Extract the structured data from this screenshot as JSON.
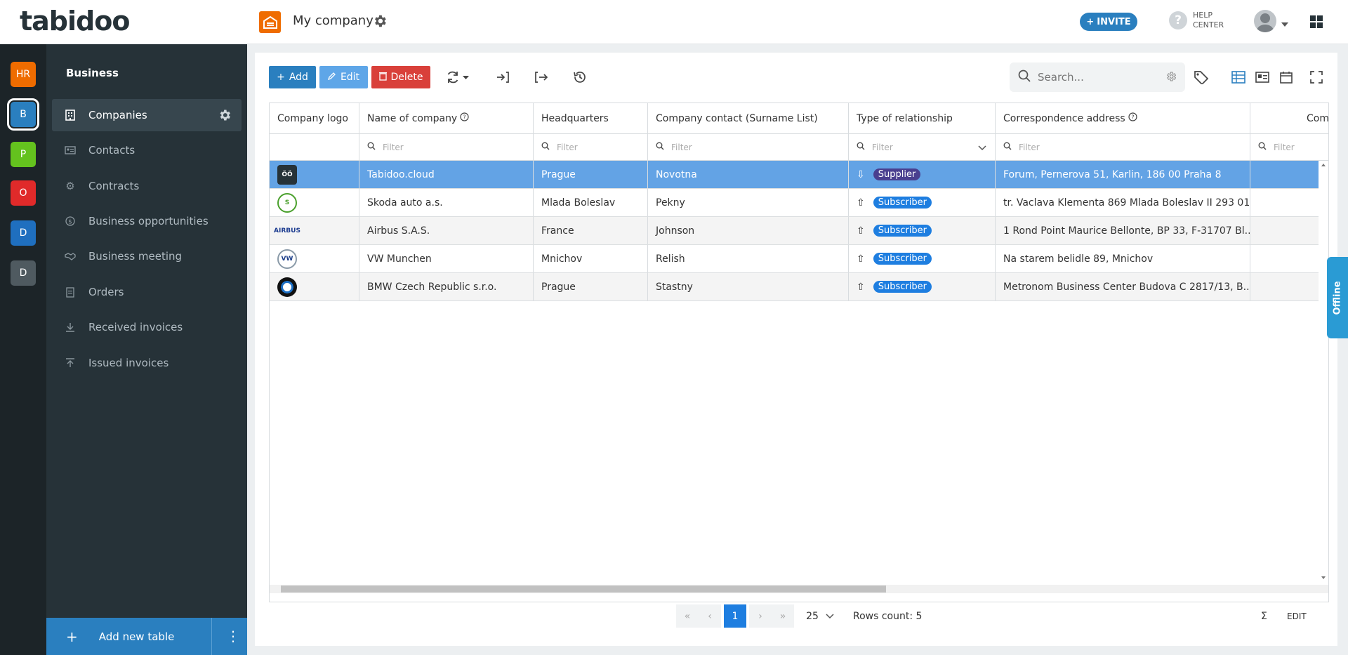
{
  "app": {
    "logo_text": "tabidoo",
    "workspace_title": "My company",
    "invite_label": "INVITE",
    "help_line1": "HELP",
    "help_line2": "CENTER"
  },
  "rail": [
    {
      "label": "HR",
      "color": "#ef6c00"
    },
    {
      "label": "B",
      "color": "#2a7fbf",
      "active": true
    },
    {
      "label": "P",
      "color": "#64c21e"
    },
    {
      "label": "O",
      "color": "#e02a2a"
    },
    {
      "label": "D",
      "color": "#1f6fbf"
    },
    {
      "label": "D",
      "color": "#4f5a60"
    }
  ],
  "sidebar": {
    "title": "Business",
    "items": [
      {
        "label": "Companies",
        "icon": "building-icon"
      },
      {
        "label": "Contacts",
        "icon": "contact-card-icon"
      },
      {
        "label": "Contracts",
        "icon": "gear-icon"
      },
      {
        "label": "Business opportunities",
        "icon": "dollar-icon"
      },
      {
        "label": "Business meeting",
        "icon": "handshake-icon"
      },
      {
        "label": "Orders",
        "icon": "document-icon"
      },
      {
        "label": "Received invoices",
        "icon": "download-icon"
      },
      {
        "label": "Issued invoices",
        "icon": "upload-icon"
      }
    ],
    "add_table_label": "Add new table"
  },
  "toolbar": {
    "add_label": "Add",
    "edit_label": "Edit",
    "delete_label": "Delete",
    "search_placeholder": "Search..."
  },
  "table": {
    "columns": [
      "Company logo",
      "Name of company",
      "Headquarters",
      "Company contact (Surname List)",
      "Type of relationship",
      "Correspondence address",
      "Compar"
    ],
    "filter_placeholder": "Filter",
    "rows": [
      {
        "name": "Tabidoo.cloud",
        "hq": "Prague",
        "contact": "Novotna",
        "type": "Supplier",
        "address": "Forum, Pernerova 51, Karlin, 186 00 Praha 8"
      },
      {
        "name": "Skoda auto a.s.",
        "hq": "Mlada Boleslav",
        "contact": "Pekny",
        "type": "Subscriber",
        "address": "tr. Vaclava Klementa 869 Mlada Boleslav II 293 01..."
      },
      {
        "name": "Airbus S.A.S.",
        "hq": "France",
        "contact": "Johnson",
        "type": "Subscriber",
        "address": "1 Rond Point Maurice Bellonte, BP 33, F-31707 Bl..."
      },
      {
        "name": "VW Munchen",
        "hq": "Mnichov",
        "contact": "Relish",
        "type": "Subscriber",
        "address": "Na starem belidle 89, Mnichov"
      },
      {
        "name": "BMW Czech Republic s.r.o.",
        "hq": "Prague",
        "contact": "Stastny",
        "type": "Subscriber",
        "address": "Metronom Business Center Budova C 2817/13, B..."
      }
    ],
    "tag_colors": {
      "Supplier": "#4a3f8f",
      "Subscriber": "#1e7ee0"
    }
  },
  "pager": {
    "current_page": "1",
    "page_size": "25",
    "rows_count": "Rows count: 5",
    "sum_symbol": "Σ",
    "edit_label": "EDIT"
  },
  "offline_label": "Offline"
}
